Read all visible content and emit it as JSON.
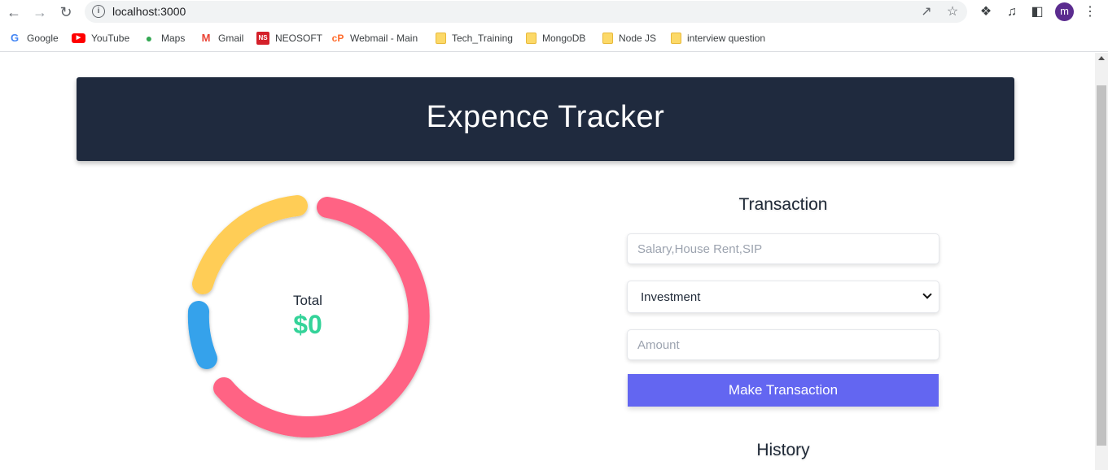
{
  "browser": {
    "url": "localhost:3000",
    "avatar_letter": "m",
    "bookmarks": [
      {
        "label": "Google",
        "icon": "google-icon"
      },
      {
        "label": "YouTube",
        "icon": "youtube-icon"
      },
      {
        "label": "Maps",
        "icon": "maps-icon"
      },
      {
        "label": "Gmail",
        "icon": "gmail-icon"
      },
      {
        "label": "NEOSOFT",
        "icon": "neosoft-icon"
      },
      {
        "label": "Webmail - Main",
        "icon": "cpanel-icon"
      },
      {
        "label": "Tech_Training",
        "icon": "folder-icon"
      },
      {
        "label": "MongoDB",
        "icon": "folder-icon"
      },
      {
        "label": "Node JS",
        "icon": "folder-icon"
      },
      {
        "label": "interview question",
        "icon": "folder-icon"
      }
    ]
  },
  "header": {
    "title": "Expence Tracker"
  },
  "summary": {
    "label": "Total",
    "value": "$0"
  },
  "chart_data": {
    "type": "pie",
    "variant": "doughnut",
    "colors": [
      "#ff6384",
      "#36a2eb",
      "#ffcd56"
    ]
  },
  "form": {
    "title": "Transaction",
    "name_placeholder": "Salary,House Rent,SIP",
    "type_selected": "Investment",
    "amount_placeholder": "Amount",
    "submit_label": "Make Transaction"
  },
  "history": {
    "title": "History"
  }
}
